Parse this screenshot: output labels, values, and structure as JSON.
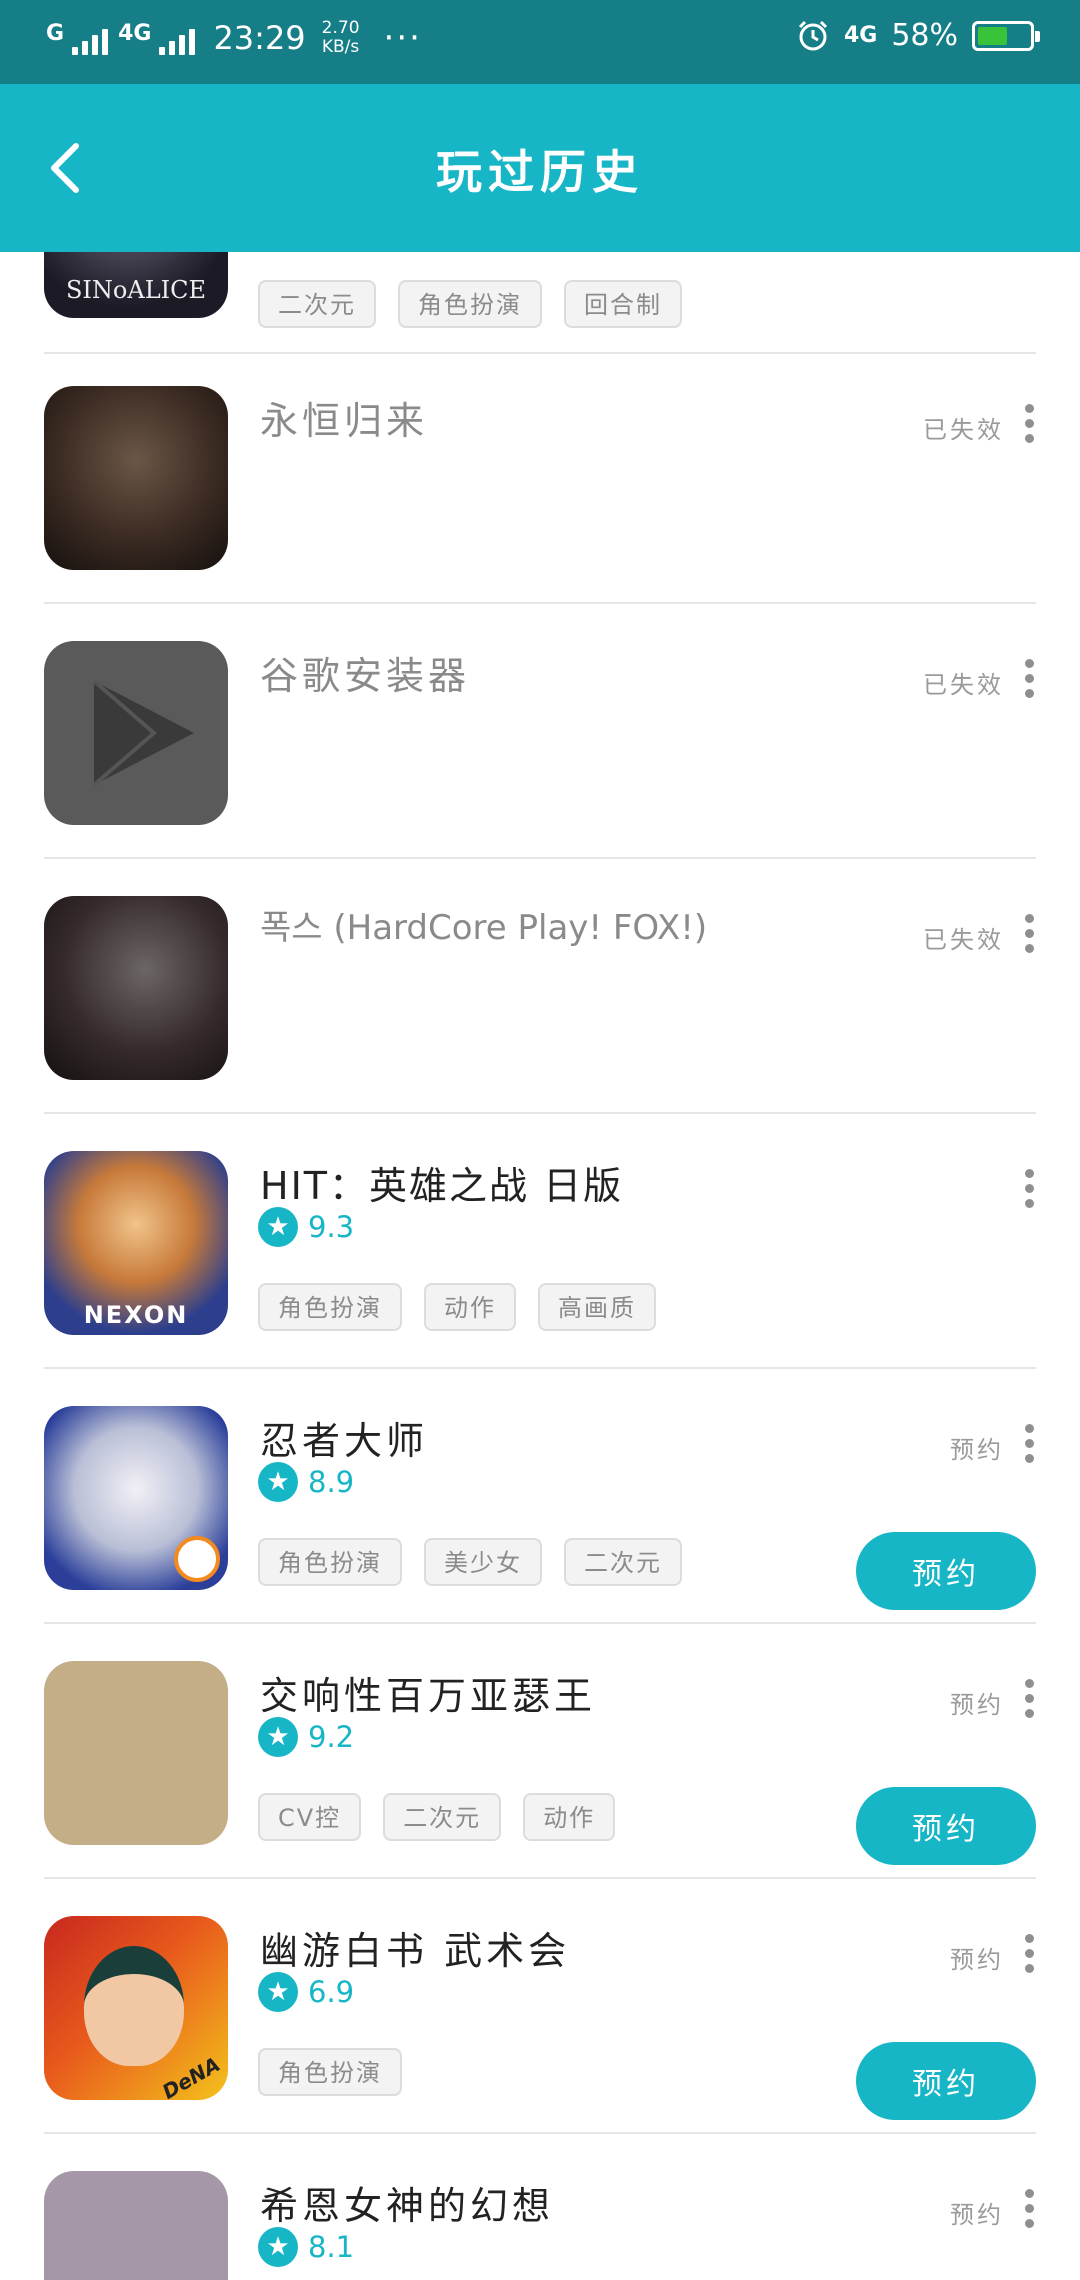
{
  "status_bar": {
    "network_left": "G",
    "network_right": "4G",
    "time": "23:29",
    "speed_value": "2.70",
    "speed_unit": "KB/s",
    "more": "···",
    "net_type": "4G",
    "battery": "58%",
    "battery_level": 0.58
  },
  "header": {
    "title": "玩过历史",
    "back_icon": "chevron-left-icon"
  },
  "items": [
    {
      "name": "SINoALICE",
      "icon_text": "SINoALICE",
      "tags": [
        "二次元",
        "角色扮演",
        "回合制"
      ]
    },
    {
      "name": "永恒归来",
      "status": "已失效"
    },
    {
      "name": "谷歌安装器",
      "status": "已失效"
    },
    {
      "name": "폭스 (HardCore Play! FOX!)",
      "status": "已失效"
    },
    {
      "name": "HIT：英雄之战 日版",
      "rating": "9.3",
      "icon_text": "NEXON",
      "tags": [
        "角色扮演",
        "动作",
        "高画质"
      ]
    },
    {
      "name": "忍者大师",
      "rating": "8.9",
      "status": "预约",
      "button": "预约",
      "tags": [
        "角色扮演",
        "美少女",
        "二次元"
      ]
    },
    {
      "name": "交响性百万亚瑟王",
      "rating": "9.2",
      "status": "预约",
      "button": "预约",
      "tags": [
        "CV控",
        "二次元",
        "动作"
      ]
    },
    {
      "name": "幽游白书 武术会",
      "rating": "6.9",
      "status": "预约",
      "button": "预约",
      "icon_text": "DeNA",
      "tags": [
        "角色扮演"
      ]
    },
    {
      "name": "希恩女神的幻想",
      "rating": "8.1",
      "status": "预约"
    }
  ],
  "colors": {
    "accent": "#17b6c6",
    "status_bar": "#167e87"
  }
}
